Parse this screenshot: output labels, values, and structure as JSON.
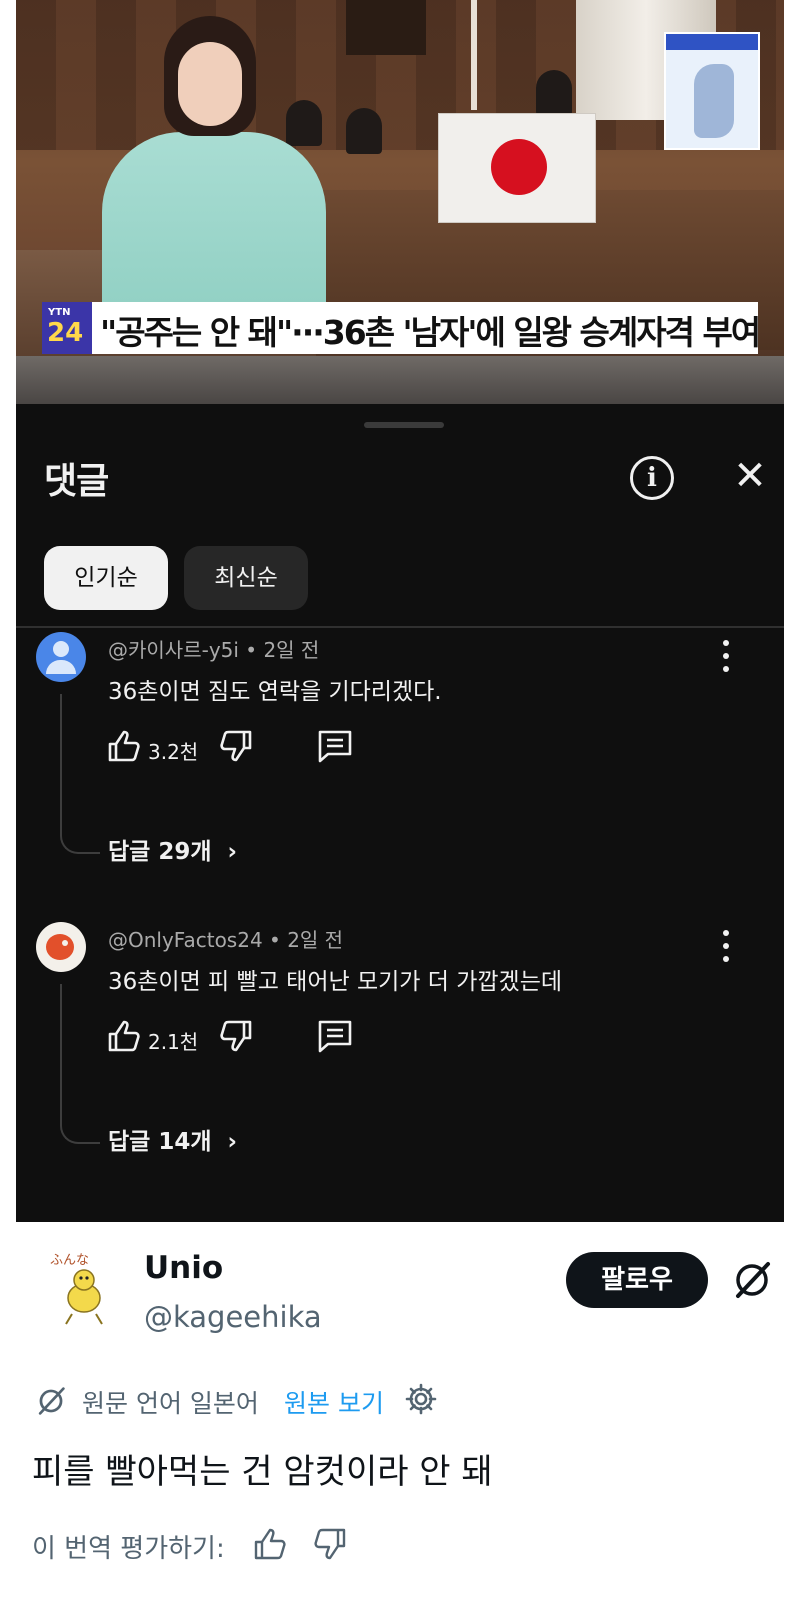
{
  "video": {
    "channel_logo_top": "YTN",
    "channel_logo_bottom": "24",
    "headline": "\"공주는 안 돼\"···36촌 '남자'에 일왕 승계자격 부여"
  },
  "comments_panel": {
    "title": "댓글",
    "sort_tabs": [
      {
        "label": "인기순",
        "active": true
      },
      {
        "label": "최신순",
        "active": false
      }
    ],
    "comments": [
      {
        "author": "@카이사르-y5i",
        "time": "2일 전",
        "text": "36촌이면 짐도 연락을 기다리겠다.",
        "likes": "3.2천",
        "replies": "답글 29개"
      },
      {
        "author": "@OnlyFactos24",
        "time": "2일 전",
        "text": "36촌이면 피 빨고 태어난 모기가 더 가깝겠는데",
        "likes": "2.1천",
        "replies": "답글 14개"
      }
    ]
  },
  "tweet": {
    "display_name": "Unio",
    "handle": "@kageehika",
    "follow_label": "팔로우",
    "avatar_caption": "ふんな",
    "translation_note": "원문 언어 일본어",
    "view_original": "원본 보기",
    "body": "피를 빨아먹는 건 암컷이라 안 돼",
    "rate_prompt": "이 번역 평가하기:"
  },
  "colors": {
    "panel_bg": "#0f0f0f",
    "chip_active_bg": "#f1f1f1",
    "chip_idle_bg": "#272727",
    "link_blue": "#1d9bf0",
    "follow_bg": "#0f1419"
  }
}
